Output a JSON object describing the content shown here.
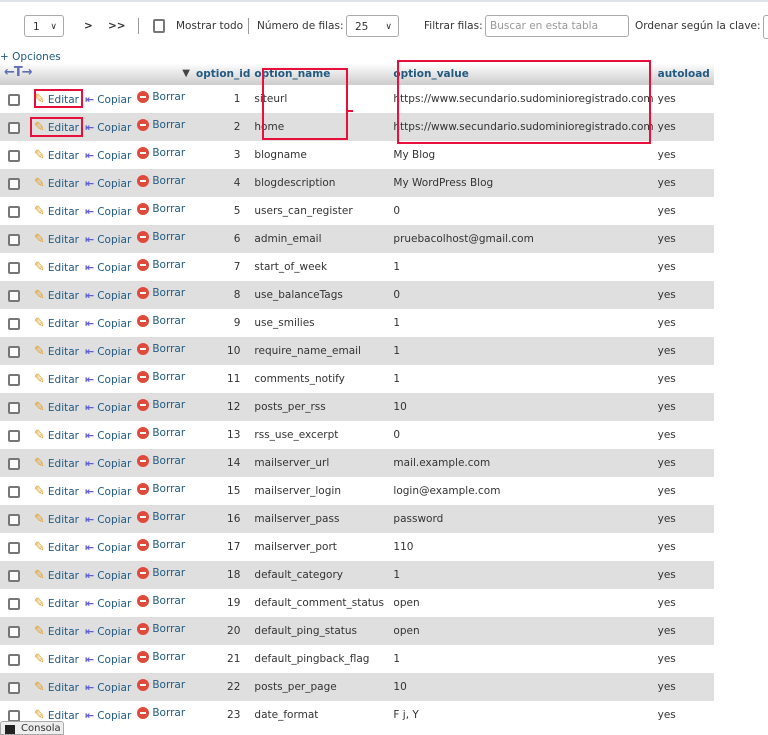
{
  "nav": {
    "page": "1",
    "next": ">",
    "last": ">>",
    "show_all": "Mostrar todo",
    "rows_label": "Número de filas:",
    "rows_value": "25",
    "filter_label": "Filtrar filas:",
    "filter_placeholder": "Buscar en esta tabla",
    "sort_label": "Ordenar según la clave:"
  },
  "options_link": "+ Opciones",
  "columns": [
    "option_id",
    "option_name",
    "option_value",
    "autoload"
  ],
  "actions": {
    "edit": "Editar",
    "copy": "Copiar",
    "delete": "Borrar"
  },
  "rows": [
    [
      "1",
      "siteurl",
      "https://www.secundario.sudominioregistrado.com",
      "yes"
    ],
    [
      "2",
      "home",
      "https://www.secundario.sudominioregistrado.com",
      "yes"
    ],
    [
      "3",
      "blogname",
      "My Blog",
      "yes"
    ],
    [
      "4",
      "blogdescription",
      "My WordPress Blog",
      "yes"
    ],
    [
      "5",
      "users_can_register",
      "0",
      "yes"
    ],
    [
      "6",
      "admin_email",
      "pruebacolhost@gmail.com",
      "yes"
    ],
    [
      "7",
      "start_of_week",
      "1",
      "yes"
    ],
    [
      "8",
      "use_balanceTags",
      "0",
      "yes"
    ],
    [
      "9",
      "use_smilies",
      "1",
      "yes"
    ],
    [
      "10",
      "require_name_email",
      "1",
      "yes"
    ],
    [
      "11",
      "comments_notify",
      "1",
      "yes"
    ],
    [
      "12",
      "posts_per_rss",
      "10",
      "yes"
    ],
    [
      "13",
      "rss_use_excerpt",
      "0",
      "yes"
    ],
    [
      "14",
      "mailserver_url",
      "mail.example.com",
      "yes"
    ],
    [
      "15",
      "mailserver_login",
      "login@example.com",
      "yes"
    ],
    [
      "16",
      "mailserver_pass",
      "password",
      "yes"
    ],
    [
      "17",
      "mailserver_port",
      "110",
      "yes"
    ],
    [
      "18",
      "default_category",
      "1",
      "yes"
    ],
    [
      "19",
      "default_comment_status",
      "open",
      "yes"
    ],
    [
      "20",
      "default_ping_status",
      "open",
      "yes"
    ],
    [
      "21",
      "default_pingback_flag",
      "1",
      "yes"
    ],
    [
      "22",
      "posts_per_page",
      "10",
      "yes"
    ],
    [
      "23",
      "date_format",
      "F j, Y",
      "yes"
    ]
  ],
  "console": "Consola",
  "highlight_color": "#e8103a"
}
